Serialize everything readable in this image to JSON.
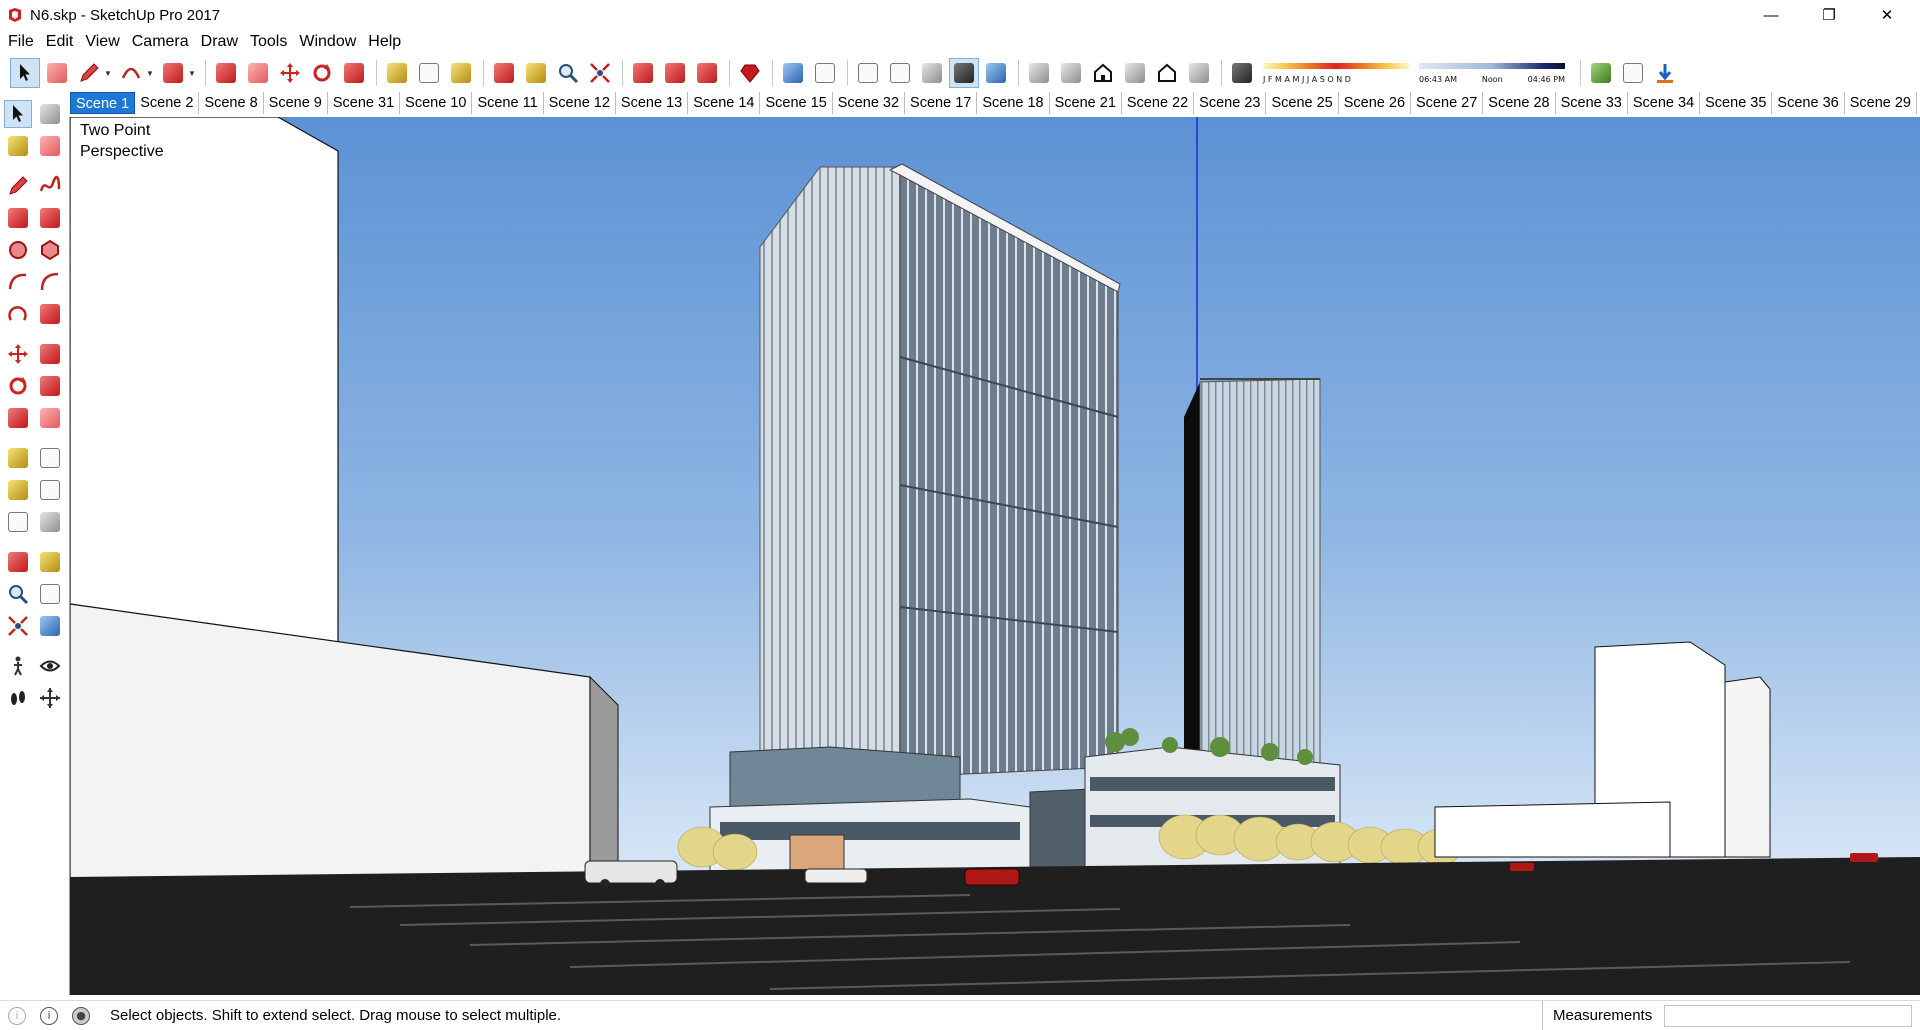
{
  "window": {
    "title": "N6.skp - SketchUp Pro 2017",
    "minimize_glyph": "—",
    "restore_glyph": "❐",
    "close_glyph": "✕"
  },
  "menu": [
    "File",
    "Edit",
    "View",
    "Camera",
    "Draw",
    "Tools",
    "Window",
    "Help"
  ],
  "toolbar": {
    "shadow_months": "J F M A M J J A S O N D",
    "time_start": "06:43 AM",
    "time_noon": "Noon",
    "time_end": "04:46 PM"
  },
  "scenes": [
    "Scene 1",
    "Scene 2",
    "Scene 8",
    "Scene 9",
    "Scene 31",
    "Scene 10",
    "Scene 11",
    "Scene 12",
    "Scene 13",
    "Scene 14",
    "Scene 15",
    "Scene 32",
    "Scene 17",
    "Scene 18",
    "Scene 21",
    "Scene 22",
    "Scene 23",
    "Scene 25",
    "Scene 26",
    "Scene 27",
    "Scene 28",
    "Scene 33",
    "Scene 34",
    "Scene 35",
    "Scene 36",
    "Scene 29"
  ],
  "active_scene": "Scene 1",
  "viewport": {
    "camera_label": "Two Point\nPerspective"
  },
  "status": {
    "message": "Select objects. Shift to extend select. Drag mouse to select multiple.",
    "measurements_label": "Measurements",
    "measurements_value": ""
  },
  "colors": {
    "accent": "#1e78d8",
    "sky_top": "#5d93d6",
    "sky_bottom": "#d7e6f5",
    "ground": "#1f1f1f"
  }
}
